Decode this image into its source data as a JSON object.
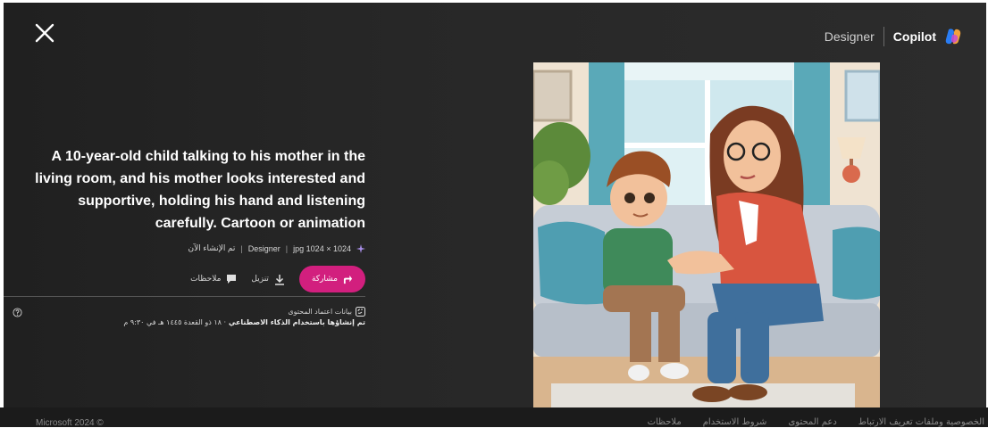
{
  "header": {
    "designer_label": "Designer",
    "copilot_label": "Copilot"
  },
  "prompt": "A 10-year-old child talking to his mother in the living room, and his mother looks interested and supportive, holding his hand and listening carefully. Cartoon or animation",
  "meta": {
    "created": "تم الإنشاء الآن",
    "source": "Designer",
    "file_info": "1024 × 1024 jpg"
  },
  "actions": {
    "share_label": "مشاركة",
    "download_label": "تنزيل",
    "feedback_label": "ملاحظات"
  },
  "credentials": {
    "title": "بيانات اعتماد المحتوى",
    "line_bold": "تم إنشاؤها باستخدام الذكاء الاصطناعي",
    "line_date": "· ١٨ ذو القعدة ١٤٤٥ هـ في ٩:٣٠ م"
  },
  "footer": {
    "copyright": "Microsoft 2024 ©",
    "links": [
      "الخصوصية وملفات تعريف الارتباط",
      "دعم المحتوى",
      "شروط الاستخدام",
      "ملاحظات"
    ]
  },
  "colors": {
    "accent": "#d21f7e",
    "background": "#262626"
  }
}
